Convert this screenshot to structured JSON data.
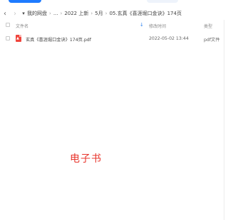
{
  "toolbar": {
    "back_icon": "chevron-left-icon",
    "forward_icon": "chevron-right-icon",
    "history_icon": "caret-down-icon"
  },
  "breadcrumb": {
    "items": [
      "我的网盘",
      "...",
      "2022 上新",
      "5月",
      "05.玄真《喜涯堀口金诀》174页"
    ],
    "separator": "›"
  },
  "table": {
    "headers": {
      "name": "文件名",
      "time": "修改时间",
      "type": "类型"
    },
    "sort_icon": "arrow-down-icon",
    "rows": [
      {
        "name": "玄真《喜涯堀口金诀》174页.pdf",
        "time": "2022-05-02 13:44",
        "type": "pdf文件",
        "icon": "pdf-icon"
      }
    ]
  },
  "overlay": {
    "text": "电子书"
  },
  "colors": {
    "accent": "#1e7bff",
    "pdf": "#f0443c",
    "overlay": "#e8352c"
  }
}
